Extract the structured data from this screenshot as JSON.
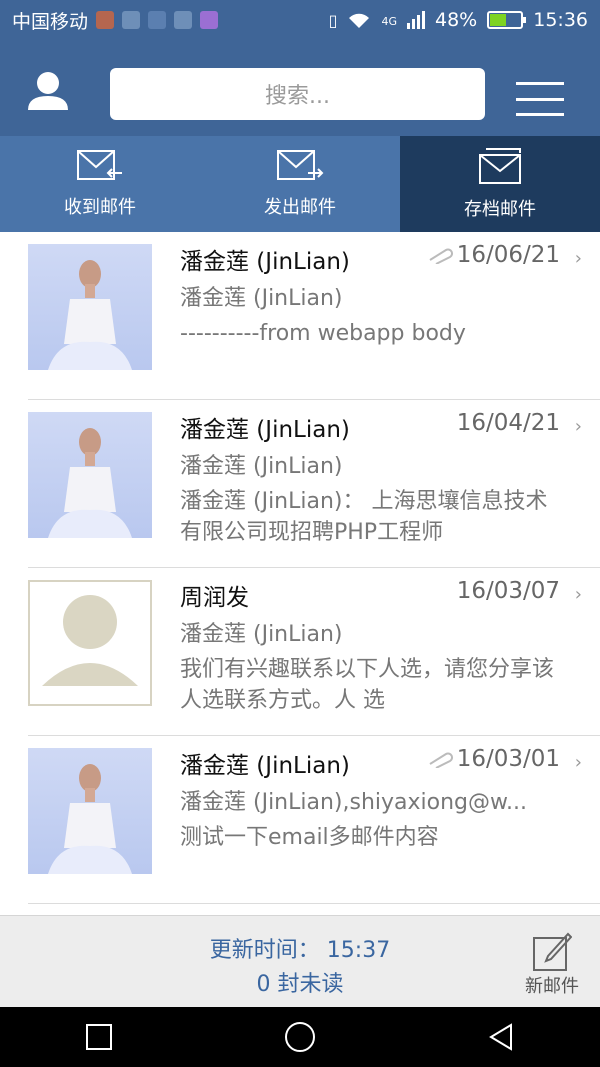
{
  "status": {
    "carrier": "中国移动",
    "network": "4G",
    "battery": "48%",
    "time": "15:36",
    "battery_level": 0.48
  },
  "search": {
    "placeholder": "搜索..."
  },
  "tabs": [
    {
      "label": "收到邮件"
    },
    {
      "label": "发出邮件"
    },
    {
      "label": "存档邮件"
    }
  ],
  "emails": [
    {
      "name": "潘金莲 (JinLian)",
      "date": "16/06/21",
      "from": "潘金莲 (JinLian)",
      "body": "----------from webapp body"
    },
    {
      "name": "潘金莲 (JinLian)",
      "date": "16/04/21",
      "from": "潘金莲 (JinLian)",
      "body": "潘金莲 (JinLian)： 上海思壤信息技术有限公司现招聘PHP工程师"
    },
    {
      "name": "周润发",
      "date": "16/03/07",
      "from": "潘金莲 (JinLian)",
      "body": "我们有兴趣联系以下人选，请您分享该人选联系方式。人  选"
    },
    {
      "name": "潘金莲 (JinLian)",
      "date": "16/03/01",
      "from": "潘金莲 (JinLian),shiyaxiong@w...",
      "body": "测试一下email多邮件内容"
    }
  ],
  "footer": {
    "update": "更新时间： 15:37",
    "unread": "0 封未读",
    "compose": "新邮件"
  },
  "colors": {
    "accent": "#3f6597",
    "active_tab": "#1e3b5e",
    "link": "#3a66a0"
  }
}
